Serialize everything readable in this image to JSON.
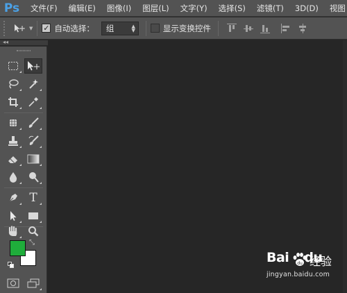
{
  "app": {
    "logo_text": "Ps"
  },
  "menu": {
    "items": [
      "文件(F)",
      "编辑(E)",
      "图像(I)",
      "图层(L)",
      "文字(Y)",
      "选择(S)",
      "滤镜(T)",
      "3D(D)",
      "视图"
    ]
  },
  "options_bar": {
    "auto_select_checked": true,
    "auto_select_label": "自动选择：",
    "auto_select_target": "组",
    "show_transform_checked": false,
    "show_transform_label": "显示变换控件"
  },
  "colors": {
    "foreground": "#1fad3b",
    "background": "#ffffff",
    "accent": "#4ba1e6"
  },
  "tools": [
    "marquee-icon",
    "move-icon",
    "lasso-icon",
    "magic-wand-icon",
    "crop-icon",
    "eyedropper-icon",
    "spot-healing-icon",
    "brush-icon",
    "clone-stamp-icon",
    "history-brush-icon",
    "eraser-icon",
    "gradient-icon",
    "blur-icon",
    "dodge-icon",
    "pen-icon",
    "type-icon",
    "path-selection-icon",
    "rectangle-icon",
    "hand-icon",
    "zoom-icon",
    "quick-mask-icon",
    "screen-mode-icon"
  ],
  "watermark": {
    "logo": "Bai",
    "logo_suffix": "du",
    "cn": "经验",
    "url": "jingyan.baidu.com"
  }
}
